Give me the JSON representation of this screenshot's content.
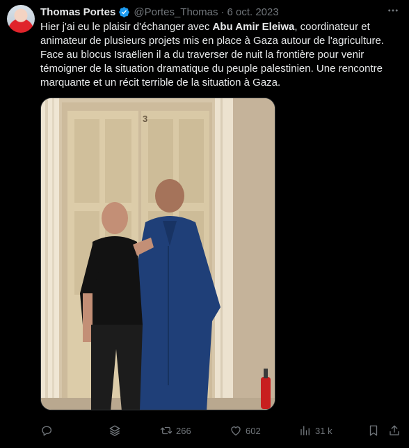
{
  "author": {
    "name": "Thomas Portes",
    "handle": "@Portes_Thomas",
    "separator": "·",
    "date": "6 oct. 2023"
  },
  "tweet": {
    "text_part1": "Hier j'ai eu le plaisir d'échanger avec ",
    "text_bold": "Abu Amir Eleiwa",
    "text_part2": ", coordinateur et animateur de plusieurs projets mis en place à Gaza autour de l'agriculture. Face au blocus Israëlien il a du traverser de nuit la frontière pour venir témoigner de la situation dramatique du peuple palestinien. Une rencontre marquante et un récit terrible de la situation à Gaza."
  },
  "media": {
    "door_number": "3"
  },
  "actions": {
    "retweets": "266",
    "likes": "602",
    "views": "31 k"
  },
  "colors": {
    "background": "#000000",
    "text": "#e7e9ea",
    "muted": "#71767b",
    "verified": "#1d9bf0"
  }
}
